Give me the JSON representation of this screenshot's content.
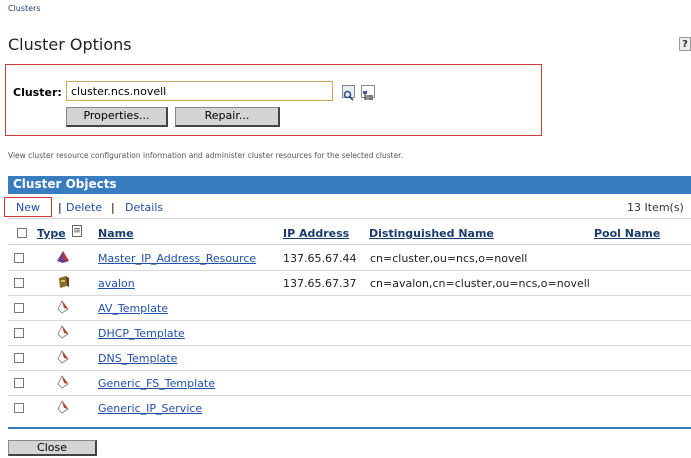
{
  "breadcrumb": "Clusters",
  "page_title": "Cluster Options",
  "help_label": "?",
  "cluster": {
    "label": "Cluster:",
    "value": "cluster.ncs.novell",
    "properties_label": "Properties...",
    "repair_label": "Repair..."
  },
  "description": "View cluster resource configuration information and administer cluster resources for the selected cluster.",
  "objects": {
    "title": "Cluster Objects",
    "toolbar": {
      "new": "New",
      "sep": "|",
      "delete": "Delete",
      "details": "Details"
    },
    "count": "13 Item(s)",
    "headers": {
      "type": "Type",
      "name": "Name",
      "ip": "IP Address",
      "dn": "Distinguished Name",
      "pool": "Pool Name"
    },
    "rows": [
      {
        "icon": "master-resource-icon",
        "name": "Master_IP_Address_Resource",
        "ip": "137.65.67.44",
        "dn": "cn=cluster,ou=ncs,o=novell"
      },
      {
        "icon": "server-node-icon",
        "name": "avalon",
        "ip": "137.65.67.37",
        "dn": "cn=avalon,cn=cluster,ou=ncs,o=novell"
      },
      {
        "icon": "template-icon",
        "name": "AV_Template",
        "ip": "",
        "dn": ""
      },
      {
        "icon": "template-icon",
        "name": "DHCP_Template",
        "ip": "",
        "dn": ""
      },
      {
        "icon": "template-icon",
        "name": "DNS_Template",
        "ip": "",
        "dn": ""
      },
      {
        "icon": "template-icon",
        "name": "Generic_FS_Template",
        "ip": "",
        "dn": ""
      },
      {
        "icon": "template-icon",
        "name": "Generic_IP_Service",
        "ip": "",
        "dn": ""
      }
    ]
  },
  "close_label": "Close",
  "colors": {
    "header_blue": "#3a7cc0",
    "link_blue": "#2150a8",
    "highlight_red": "#d23a3a"
  }
}
